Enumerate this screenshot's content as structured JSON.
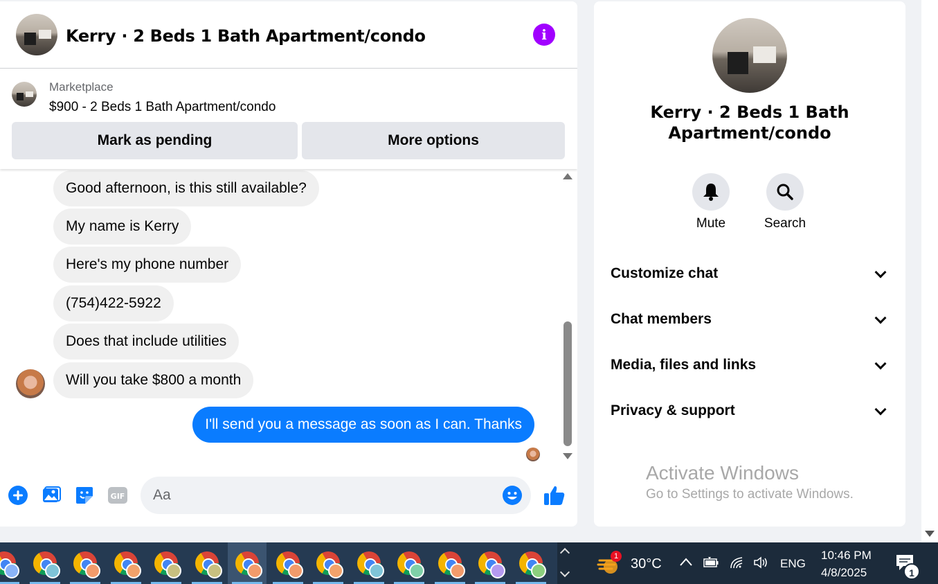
{
  "chat": {
    "title": "Kerry · 2 Beds 1 Bath Apartment/condo",
    "info_icon": "i",
    "marketplace": {
      "label": "Marketplace",
      "listing": "$900 - 2 Beds 1 Bath Apartment/condo",
      "mark_pending": "Mark as pending",
      "more_options": "More options"
    },
    "messages": [
      {
        "text": "Good afternoon, is this still available?",
        "direction": "incoming"
      },
      {
        "text": "My name is Kerry",
        "direction": "incoming"
      },
      {
        "text": "Here's my phone number",
        "direction": "incoming"
      },
      {
        "text": "(754)422-5922",
        "direction": "incoming"
      },
      {
        "text": "Does that include utilities",
        "direction": "incoming"
      },
      {
        "text": "Will you take $800 a month",
        "direction": "incoming"
      },
      {
        "text": "I'll send you a message as soon as I can. Thanks",
        "direction": "outgoing"
      }
    ],
    "composer": {
      "placeholder": "Aa",
      "icons": [
        "plus-icon",
        "image-icon",
        "sticker-icon",
        "gif-icon",
        "emoji-icon",
        "like-icon"
      ]
    }
  },
  "info_panel": {
    "title": "Kerry · 2 Beds 1 Bath Apartment/condo",
    "actions": [
      {
        "label": "Mute",
        "icon": "bell-icon"
      },
      {
        "label": "Search",
        "icon": "search-icon"
      }
    ],
    "sections": [
      {
        "label": "Customize chat"
      },
      {
        "label": "Chat members"
      },
      {
        "label": "Media, files and links"
      },
      {
        "label": "Privacy & support"
      }
    ],
    "watermark": {
      "heading": "Activate Windows",
      "sub": "Go to Settings to activate Windows."
    }
  },
  "taskbar": {
    "app_count": 14,
    "active_index": 6,
    "weather": {
      "temp": "30°C",
      "badge": "1"
    },
    "language": "ENG",
    "time": "10:46 PM",
    "date": "4/8/2025",
    "notification_count": "1"
  },
  "colors": {
    "accent_blue": "#0a7cff",
    "info_purple": "#a100ff",
    "bubble_grey": "#f0f0f0",
    "taskbar": "#1c2b3b"
  }
}
